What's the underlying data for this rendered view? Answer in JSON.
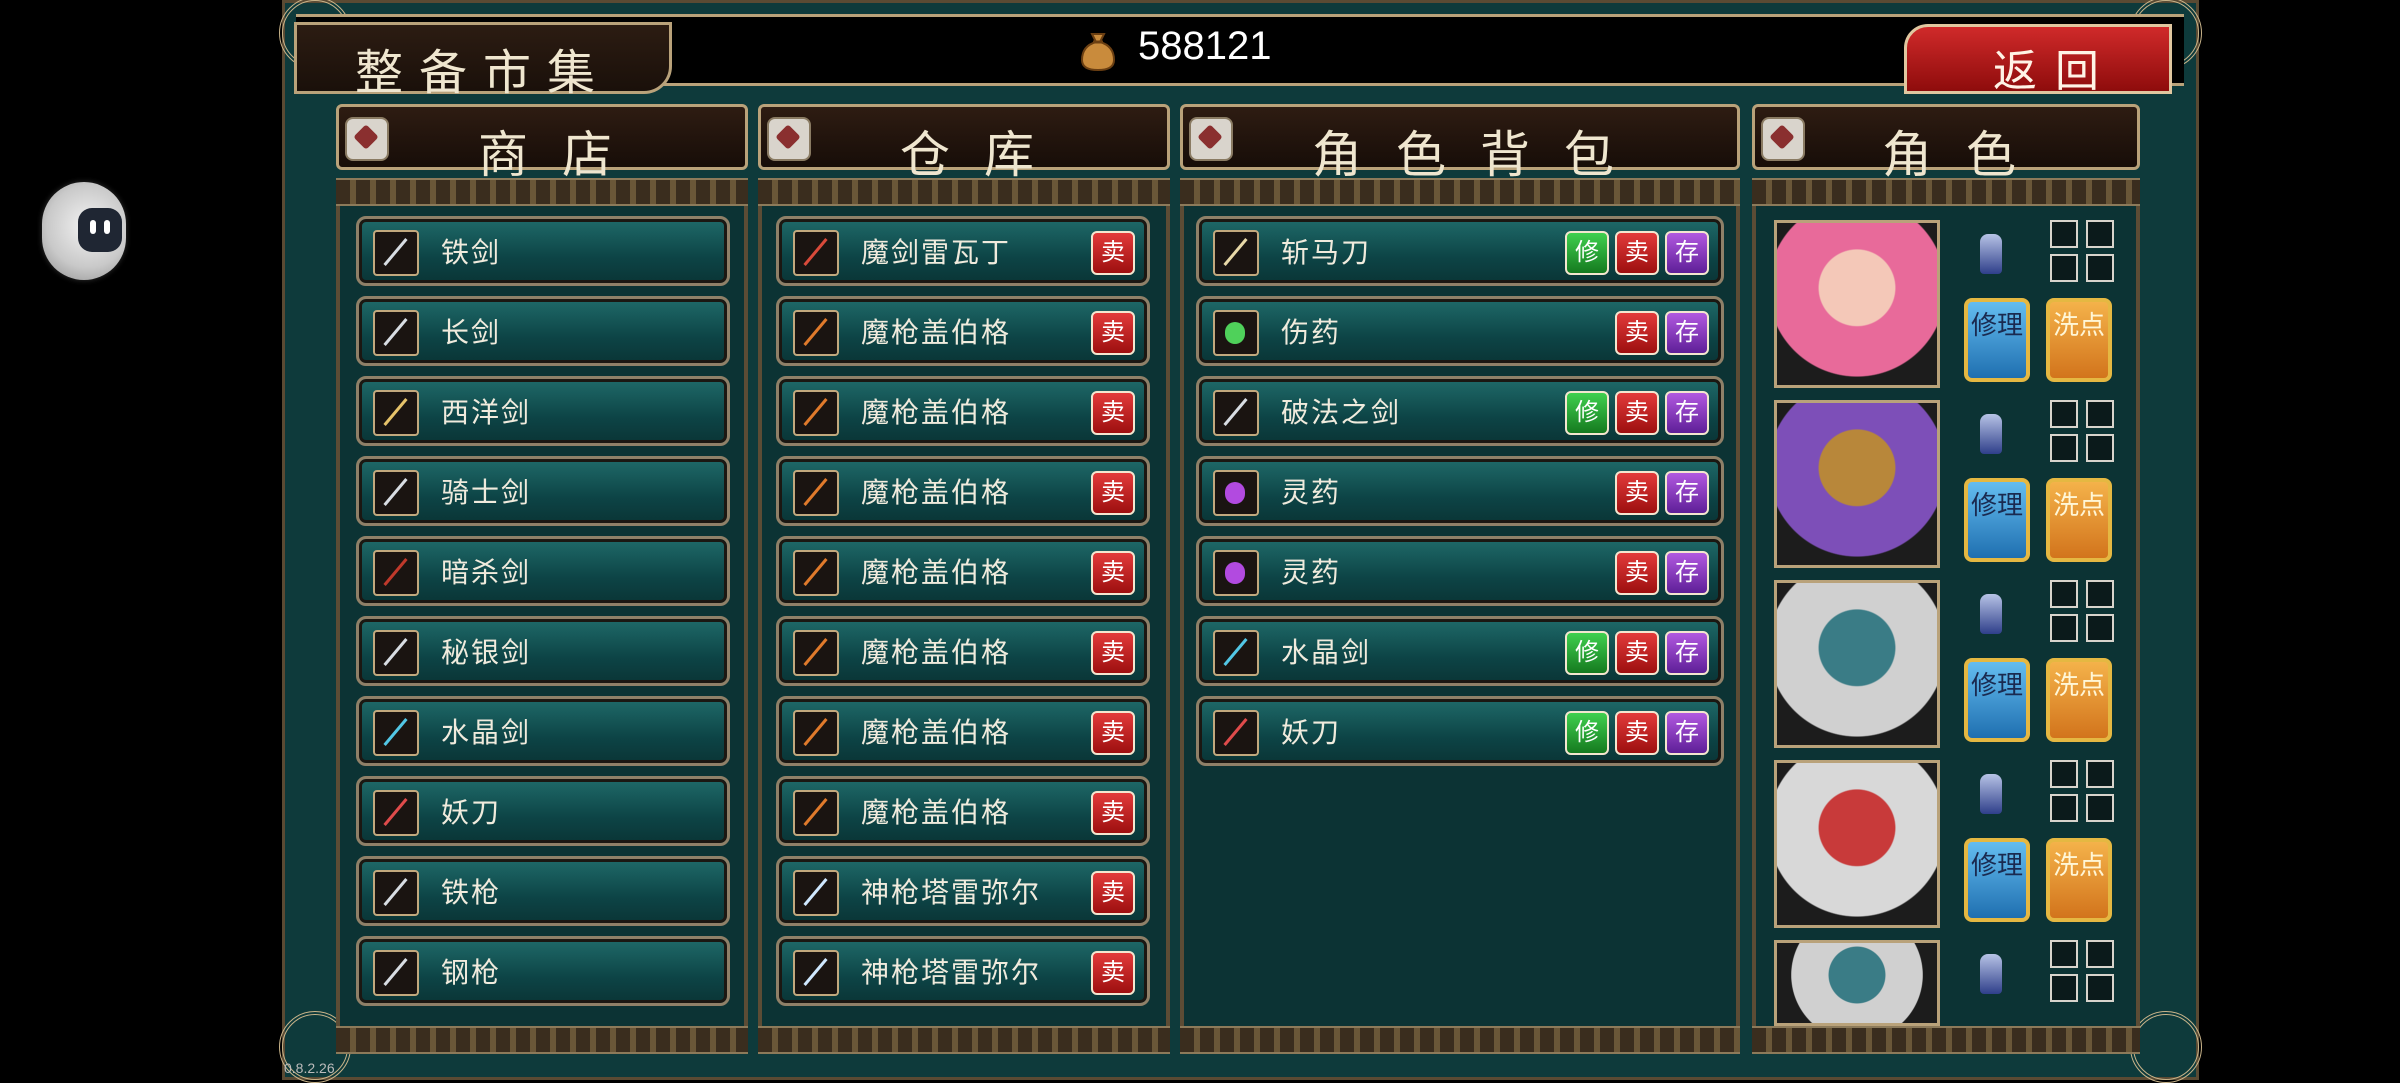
{
  "header": {
    "title": "整备市集",
    "gold_icon": "money-bag-icon",
    "gold": "588121",
    "back_label": "返回"
  },
  "columns": {
    "shop": "商店",
    "warehouse": "仓库",
    "bag": "角色背包",
    "character": "角色"
  },
  "buttons": {
    "sell": "卖",
    "repair": "修",
    "store": "存",
    "repair_big": "修理",
    "wash_big": "洗点"
  },
  "shop_items": [
    {
      "name": "铁剑",
      "icon": "sword-icon"
    },
    {
      "name": "长剑",
      "icon": "sword-icon"
    },
    {
      "name": "西洋剑",
      "icon": "rapier-icon"
    },
    {
      "name": "骑士剑",
      "icon": "sword-icon"
    },
    {
      "name": "暗杀剑",
      "icon": "dagger-icon"
    },
    {
      "name": "秘银剑",
      "icon": "sword-icon"
    },
    {
      "name": "水晶剑",
      "icon": "crystal-sword-icon"
    },
    {
      "name": "妖刀",
      "icon": "katana-icon"
    },
    {
      "name": "铁枪",
      "icon": "spear-icon"
    },
    {
      "name": "钢枪",
      "icon": "spear-icon"
    }
  ],
  "warehouse_items": [
    {
      "name": "魔剑雷瓦丁",
      "icon": "magic-sword-icon"
    },
    {
      "name": "魔枪盖伯格",
      "icon": "magic-lance-icon"
    },
    {
      "name": "魔枪盖伯格",
      "icon": "magic-lance-icon"
    },
    {
      "name": "魔枪盖伯格",
      "icon": "magic-lance-icon"
    },
    {
      "name": "魔枪盖伯格",
      "icon": "magic-lance-icon"
    },
    {
      "name": "魔枪盖伯格",
      "icon": "magic-lance-icon"
    },
    {
      "name": "魔枪盖伯格",
      "icon": "magic-lance-icon"
    },
    {
      "name": "魔枪盖伯格",
      "icon": "magic-lance-icon"
    },
    {
      "name": "神枪塔雷弥尔",
      "icon": "trident-icon"
    },
    {
      "name": "神枪塔雷弥尔",
      "icon": "trident-icon"
    }
  ],
  "bag_items": [
    {
      "name": "斩马刀",
      "icon": "halberd-icon",
      "repairable": true
    },
    {
      "name": "伤药",
      "icon": "potion-green-icon",
      "repairable": false
    },
    {
      "name": "破法之剑",
      "icon": "sword-icon",
      "repairable": true
    },
    {
      "name": "灵药",
      "icon": "potion-purple-icon",
      "repairable": false
    },
    {
      "name": "灵药",
      "icon": "potion-purple-icon",
      "repairable": false
    },
    {
      "name": "水晶剑",
      "icon": "crystal-sword-icon",
      "repairable": true
    },
    {
      "name": "妖刀",
      "icon": "katana-icon",
      "repairable": true
    }
  ],
  "characters": [
    {
      "portrait": "pink-hair-woman-portrait",
      "sprite": "swordsman-sprite-icon"
    },
    {
      "portrait": "purple-hair-hooded-woman-portrait",
      "sprite": "mage-sprite-icon"
    },
    {
      "portrait": "helmeted-man-portrait",
      "sprite": "knight-sprite-icon"
    },
    {
      "portrait": "helmeted-woman-portrait",
      "sprite": "soldier-sprite-icon"
    },
    {
      "portrait": "helmeted-man-portrait",
      "sprite": "lancer-sprite-icon"
    }
  ],
  "colors": {
    "panel": "#0c3334",
    "item": "#1f6a69",
    "frame": "#b9a27a",
    "sell": "#c11f1f",
    "repair": "#2aa43a",
    "store": "#8a3cc8",
    "back": "#b81a1a"
  },
  "version": "0.8.2.26"
}
